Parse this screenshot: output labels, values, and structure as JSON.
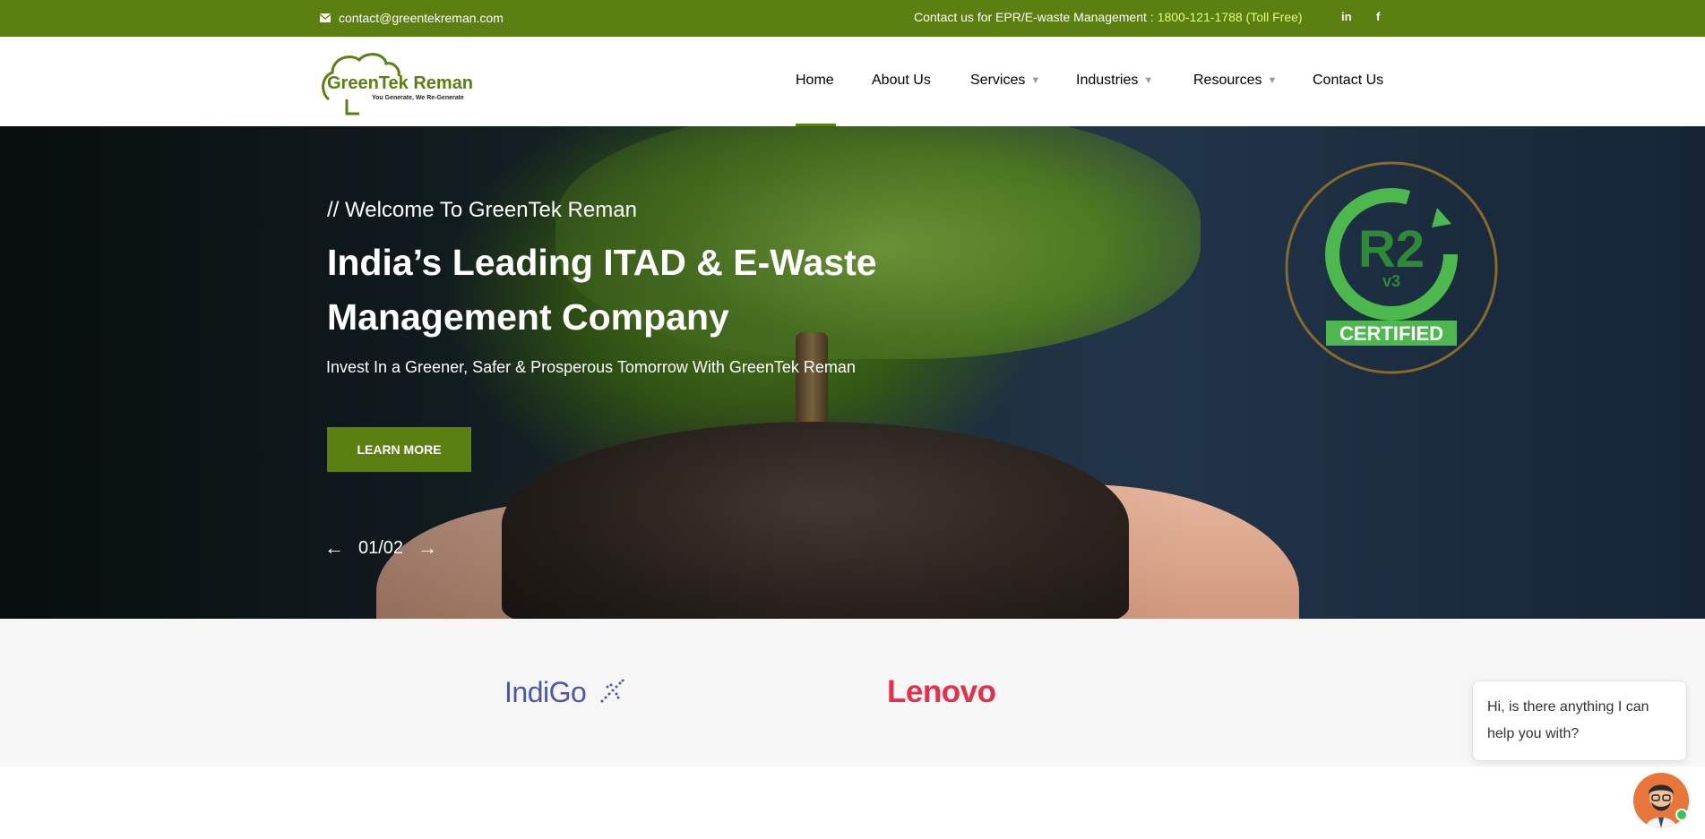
{
  "topbar": {
    "email": "contact@greentekreman.com",
    "email_icon": "envelope-icon",
    "contact_prefix": "Contact us for EPR/E-waste Management :",
    "phone": "1800-121-1788 (Toll Free)",
    "social": [
      {
        "name": "linkedin-icon",
        "label": "in"
      },
      {
        "name": "facebook-icon",
        "label": "f"
      }
    ]
  },
  "brand": {
    "name": "GreenTek Reman",
    "tagline": "You Generate, We Re-Generate",
    "primary_color": "#5c7f12"
  },
  "nav": {
    "items": [
      {
        "label": "Home",
        "active": true
      },
      {
        "label": "About Us"
      },
      {
        "label": "Services",
        "dropdown": true
      },
      {
        "label": "Industries",
        "dropdown": true
      },
      {
        "label": "Resources",
        "dropdown": true
      },
      {
        "label": "Contact Us"
      }
    ],
    "caret": "▼"
  },
  "hero": {
    "welcome": "// Welcome To GreenTek Reman",
    "headline_line1": "India’s Leading ITAD & E-Waste",
    "headline_line2": "Management Company",
    "subline": "Invest In a Greener, Safer & Prosperous Tomorrow With GreenTek Reman",
    "cta": "LEARN MORE",
    "slide_counter": "01/02",
    "prev_arrow": "←",
    "next_arrow": "→",
    "badge": {
      "title": "R2",
      "version": "v3",
      "label": "CERTIFIED"
    }
  },
  "clients": [
    {
      "name": "IndiGo"
    },
    {
      "name": "Lenovo"
    }
  ],
  "chat": {
    "message": "Hi, is there anything I can help you with?"
  }
}
